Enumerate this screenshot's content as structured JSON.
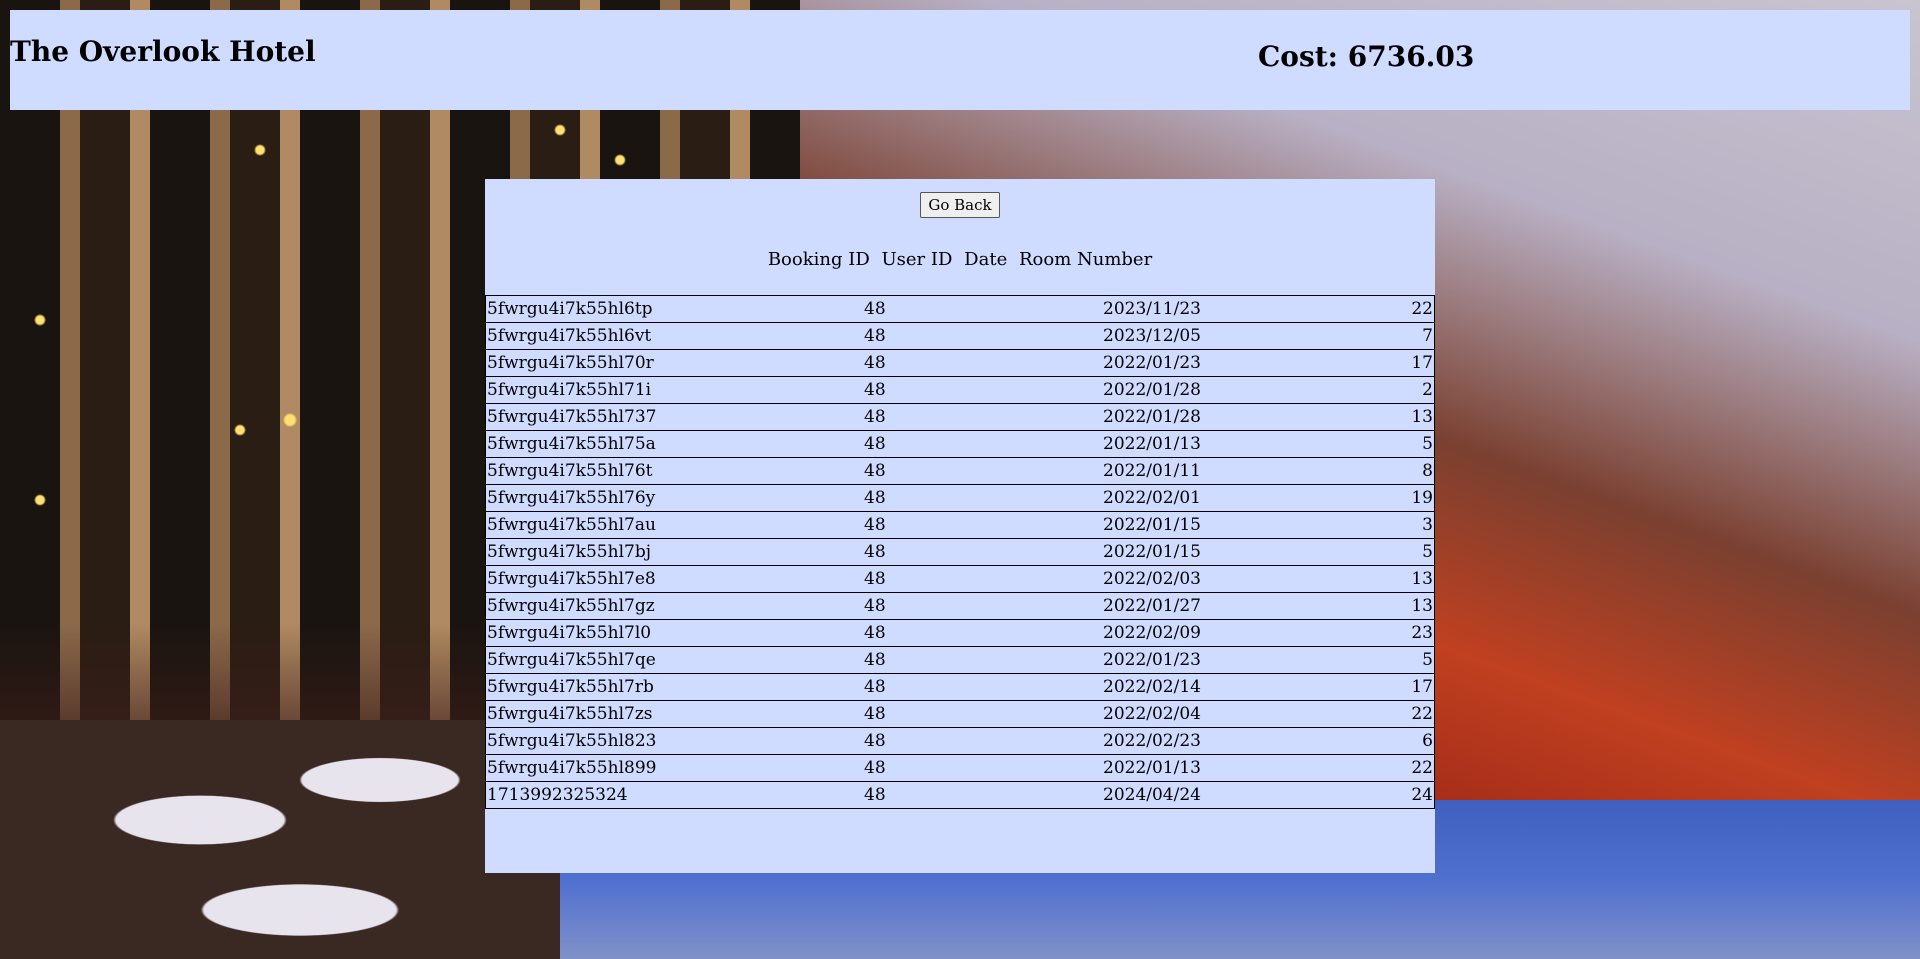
{
  "header": {
    "title": "The Overlook Hotel",
    "cost": "Cost: 6736.03"
  },
  "panel": {
    "back_label": "Go Back",
    "columns": [
      "Booking ID",
      "User ID",
      "Date",
      "Room Number"
    ],
    "rows": [
      {
        "booking_id": "5fwrgu4i7k55hl6tp",
        "user_id": "48",
        "date": "2023/11/23",
        "room": "22"
      },
      {
        "booking_id": "5fwrgu4i7k55hl6vt",
        "user_id": "48",
        "date": "2023/12/05",
        "room": "7"
      },
      {
        "booking_id": "5fwrgu4i7k55hl70r",
        "user_id": "48",
        "date": "2022/01/23",
        "room": "17"
      },
      {
        "booking_id": "5fwrgu4i7k55hl71i",
        "user_id": "48",
        "date": "2022/01/28",
        "room": "2"
      },
      {
        "booking_id": "5fwrgu4i7k55hl737",
        "user_id": "48",
        "date": "2022/01/28",
        "room": "13"
      },
      {
        "booking_id": "5fwrgu4i7k55hl75a",
        "user_id": "48",
        "date": "2022/01/13",
        "room": "5"
      },
      {
        "booking_id": "5fwrgu4i7k55hl76t",
        "user_id": "48",
        "date": "2022/01/11",
        "room": "8"
      },
      {
        "booking_id": "5fwrgu4i7k55hl76y",
        "user_id": "48",
        "date": "2022/02/01",
        "room": "19"
      },
      {
        "booking_id": "5fwrgu4i7k55hl7au",
        "user_id": "48",
        "date": "2022/01/15",
        "room": "3"
      },
      {
        "booking_id": "5fwrgu4i7k55hl7bj",
        "user_id": "48",
        "date": "2022/01/15",
        "room": "5"
      },
      {
        "booking_id": "5fwrgu4i7k55hl7e8",
        "user_id": "48",
        "date": "2022/02/03",
        "room": "13"
      },
      {
        "booking_id": "5fwrgu4i7k55hl7gz",
        "user_id": "48",
        "date": "2022/01/27",
        "room": "13"
      },
      {
        "booking_id": "5fwrgu4i7k55hl7l0",
        "user_id": "48",
        "date": "2022/02/09",
        "room": "23"
      },
      {
        "booking_id": "5fwrgu4i7k55hl7qe",
        "user_id": "48",
        "date": "2022/01/23",
        "room": "5"
      },
      {
        "booking_id": "5fwrgu4i7k55hl7rb",
        "user_id": "48",
        "date": "2022/02/14",
        "room": "17"
      },
      {
        "booking_id": "5fwrgu4i7k55hl7zs",
        "user_id": "48",
        "date": "2022/02/04",
        "room": "22"
      },
      {
        "booking_id": "5fwrgu4i7k55hl823",
        "user_id": "48",
        "date": "2022/02/23",
        "room": "6"
      },
      {
        "booking_id": "5fwrgu4i7k55hl899",
        "user_id": "48",
        "date": "2022/01/13",
        "room": "22"
      },
      {
        "booking_id": "1713992325324",
        "user_id": "48",
        "date": "2024/04/24",
        "room": "24"
      }
    ]
  }
}
